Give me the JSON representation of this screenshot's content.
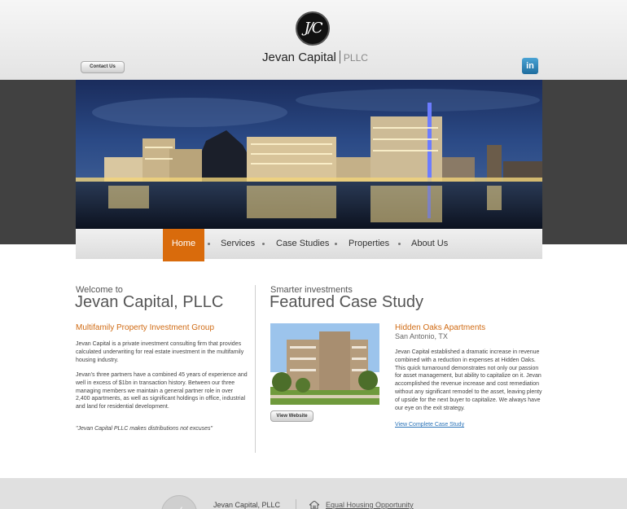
{
  "header": {
    "logo_monogram": "J/C",
    "logo_name": "Jevan Capital",
    "logo_suffix": "PLLC",
    "contact_button": "Contact Us",
    "linkedin_label": "in"
  },
  "nav": {
    "items": [
      "Home",
      "Services",
      "Case Studies",
      "Properties",
      "About Us"
    ],
    "active_index": 0
  },
  "welcome": {
    "small": "Welcome to",
    "title": "Jevan Capital, PLLC",
    "subtitle": "Multifamily Property Investment Group",
    "paragraph1": "Jevan Capital is a private investment consulting firm that provides calculated underwriting for real estate investment in the multifamily housing industry.",
    "paragraph2": "Jevan's three partners have a combined 45 years of experience and well in excess of $1bn in transaction history. Between our three managing members we maintain a general partner role in over 2,400 apartments, as well as significant holdings in office, industrial and land for residential development.",
    "quote": "\"Jevan Capital PLLC makes distributions not excuses\""
  },
  "featured": {
    "small": "Smarter investments",
    "title": "Featured Case Study",
    "property_name": "Hidden Oaks Apartments",
    "location": "San Antonio, TX",
    "description": "Jevan Capital established a dramatic increase in revenue combined with a reduction in expenses at Hidden Oaks. This quick turnaround demonstrates not only our passion for asset management, but ability to capitalize on it. Jevan accomplished the revenue increase and cost remediation without any significant remodel to the asset, leaving plenty of upside for the next buyer to capitalize. We always have our eye on the exit strategy.",
    "view_button": "View Website",
    "case_link": "View Complete Case Study"
  },
  "footer": {
    "company": "Jevan Capital, PLLC",
    "equal_housing": "Equal Housing Opportunity"
  },
  "colors": {
    "accent": "#d96b0c",
    "band": "#414141",
    "link": "#2a73b8"
  }
}
